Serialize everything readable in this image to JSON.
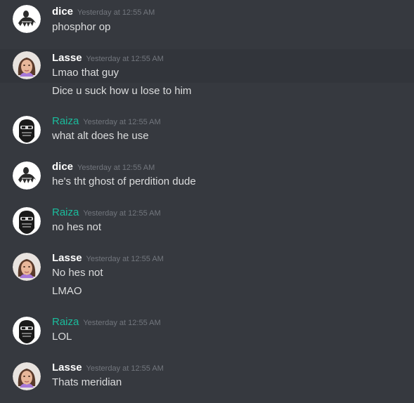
{
  "timestamp": "Yesterday at 12:55 AM",
  "messages": [
    {
      "user": "dice",
      "avatar": "ghost-avatar",
      "lines": [
        "phosphor op"
      ]
    },
    {
      "user": "Lasse",
      "avatar": "girl-avatar",
      "lines": [
        "Lmao that guy",
        "Dice u suck how u lose to him"
      ]
    },
    {
      "user": "Raiza",
      "avatar": "mask-avatar",
      "lines": [
        "what alt does he use"
      ]
    },
    {
      "user": "dice",
      "avatar": "ghost-avatar",
      "lines": [
        "he's tht ghost of perdition dude"
      ]
    },
    {
      "user": "Raiza",
      "avatar": "mask-avatar",
      "lines": [
        "no hes not"
      ]
    },
    {
      "user": "Lasse",
      "avatar": "girl-avatar",
      "lines": [
        "No hes not",
        "LMAO"
      ]
    },
    {
      "user": "Raiza",
      "avatar": "mask-avatar",
      "lines": [
        "LOL"
      ]
    },
    {
      "user": "Lasse",
      "avatar": "girl-avatar",
      "lines": [
        "Thats meridian"
      ]
    }
  ],
  "colors": {
    "background": "#36393f",
    "hover_background": "#32353b",
    "username_default": "#ffffff",
    "username_raiza": "#1abc9c",
    "timestamp": "#72767d",
    "text": "#dcddde"
  }
}
